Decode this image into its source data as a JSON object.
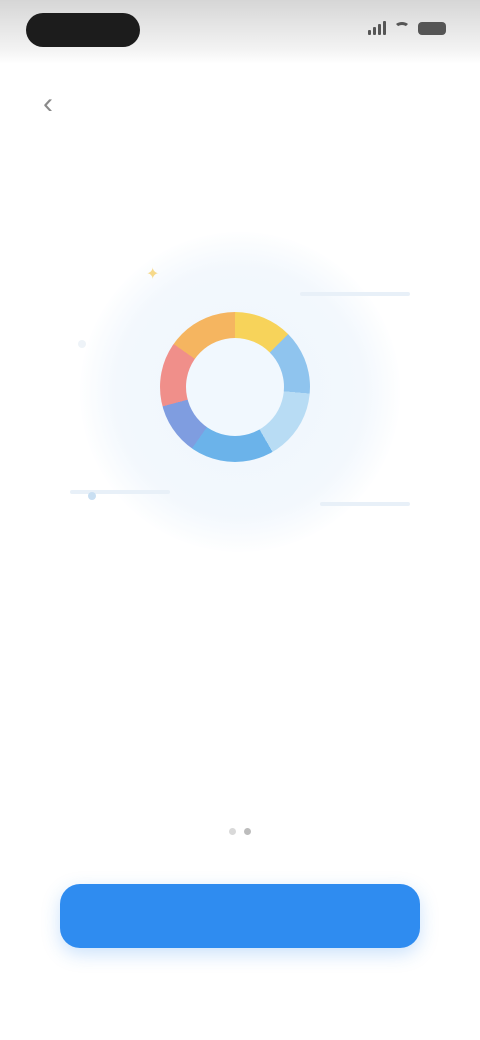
{
  "status_bar": {
    "time": ""
  },
  "nav": {
    "back_icon": "chevron-left-icon",
    "title": ""
  },
  "illustration": {
    "icons": [
      "color-ring-icon",
      "sparkle-icon"
    ]
  },
  "content": {
    "headline": "",
    "description": ""
  },
  "pager": {
    "pages": 2,
    "active_index": 1
  },
  "primary_button": {
    "label": "",
    "color": "#2f8cf0"
  }
}
